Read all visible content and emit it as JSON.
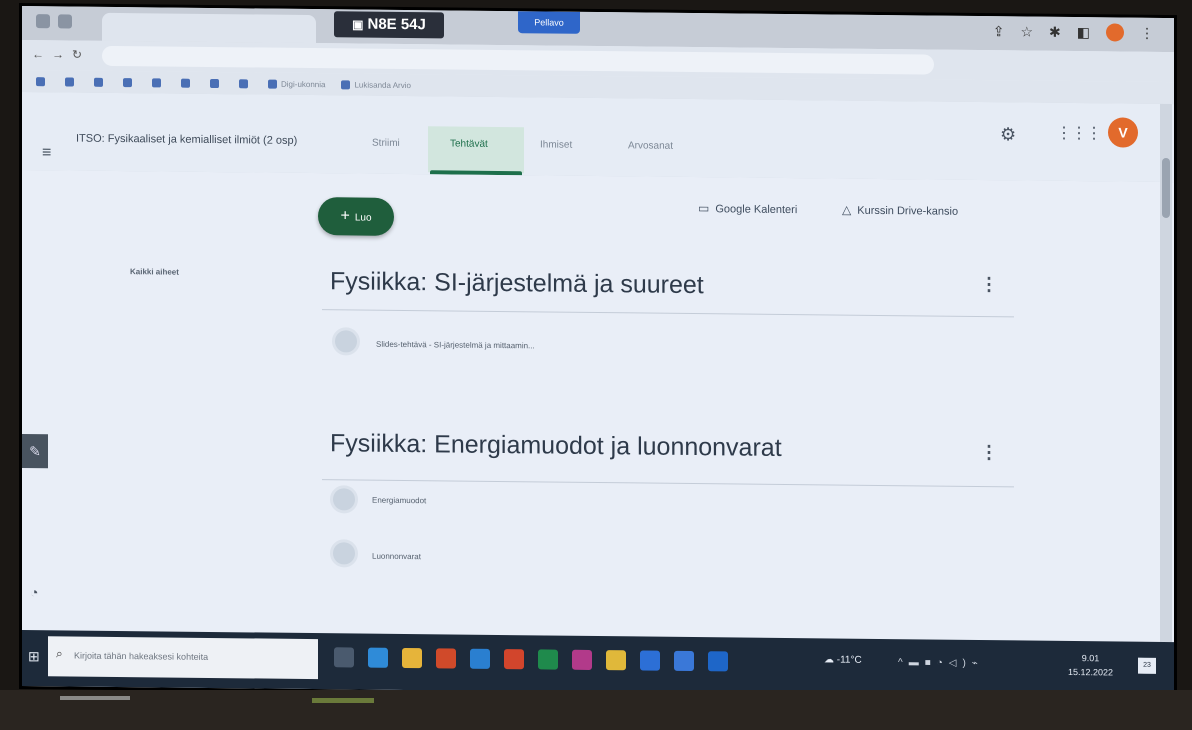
{
  "browser": {
    "overlay_code": "N8E 54J",
    "share_label": "Pellavo",
    "bookmarks": [
      "",
      "",
      "",
      "",
      "",
      "",
      "",
      "",
      "Digi-ukonnia",
      "Lukisanda Arvio"
    ]
  },
  "header": {
    "course_title": "ITSO: Fysikaaliset ja kemialliset ilmiöt (2 osp)",
    "avatar_letter": "V",
    "tabs": [
      "Striimi",
      "Tehtävät",
      "Ihmiset",
      "Arvosanat"
    ]
  },
  "toolbar": {
    "create_label": "Luo",
    "calendar_label": "Google Kalenteri",
    "drive_label": "Kurssin Drive-kansio"
  },
  "sidebar": {
    "items": [
      "Kaikki aiheet",
      "",
      "",
      "",
      "",
      "",
      "",
      "",
      ""
    ]
  },
  "topics": [
    {
      "title": "Fysiikka: SI-järjestelmä ja suureet",
      "assignments": [
        {
          "title": "Slides-tehtävä - SI-järjestelmä ja mittaamin...",
          "status": ""
        }
      ]
    },
    {
      "title": "Fysiikka: Energiamuodot ja luonnonvarat",
      "assignments": [
        {
          "title": "Energiamuodot",
          "status": ""
        },
        {
          "title": "Luonnonvarat",
          "status": ""
        }
      ]
    }
  ],
  "taskbar": {
    "search_placeholder": "Kirjoita tähän hakeaksesi kohteita",
    "temperature": "-11°C",
    "time": "9.01",
    "date": "15.12.2022",
    "notifications": "23"
  }
}
